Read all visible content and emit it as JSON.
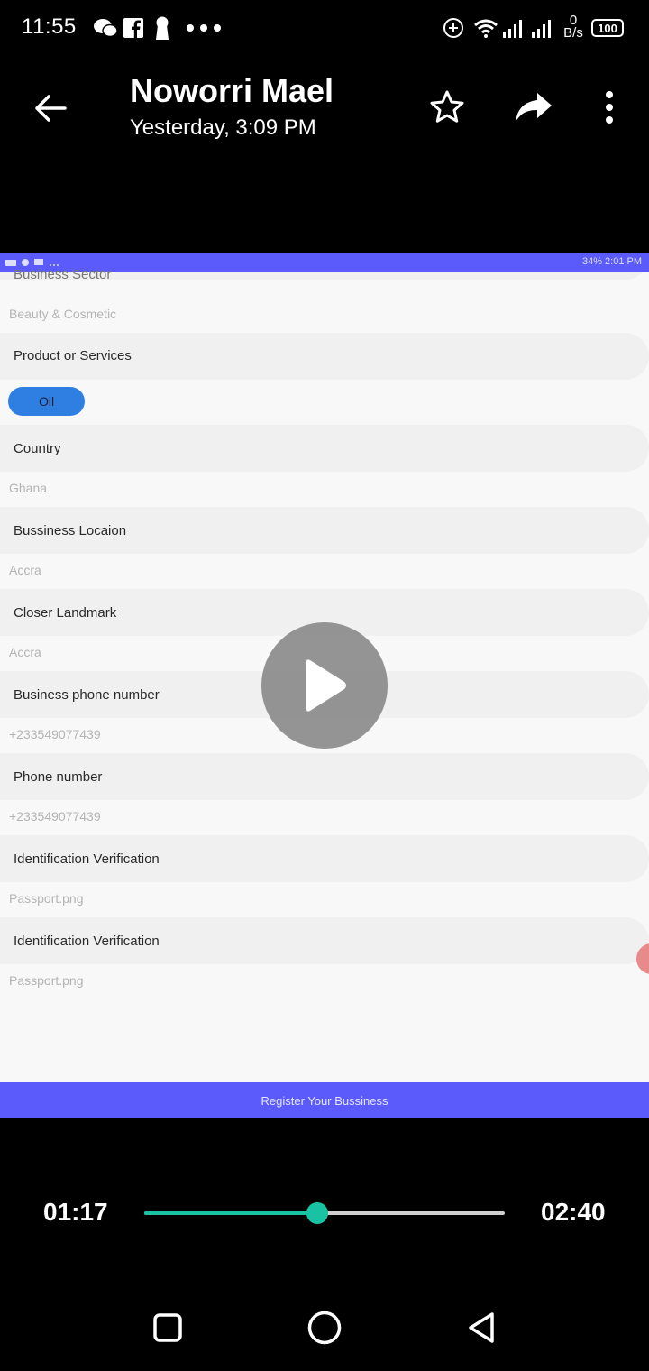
{
  "status_bar": {
    "time": "11:55",
    "left_icons": [
      "wechat-icon",
      "facebook-icon",
      "keyhole-icon",
      "more-dots-icon"
    ],
    "right_icons": [
      "data-saver-icon",
      "wifi-icon",
      "signal-icon",
      "signal-icon"
    ],
    "net_speed_value": "0",
    "net_speed_unit": "B/s",
    "battery": "100"
  },
  "header": {
    "contact_name": "Noworri Mael",
    "timestamp": "Yesterday, 3:09 PM",
    "icons": [
      "back-arrow-icon",
      "star-icon",
      "share-icon",
      "more-vert-icon"
    ]
  },
  "video": {
    "inner_status_right": "34% 2:01 PM",
    "fields": [
      {
        "label": "Business Sector",
        "value": "Beauty & Cosmetic"
      },
      {
        "label": "Product or Services",
        "chip": "Oil"
      },
      {
        "label": "Country",
        "value": "Ghana"
      },
      {
        "label": "Bussiness Locaion",
        "value": "Accra"
      },
      {
        "label": "Closer Landmark",
        "value": "Accra"
      },
      {
        "label": "Business phone number",
        "value": "+233549077439"
      },
      {
        "label": "Phone number",
        "value": "+233549077439"
      },
      {
        "label": "Identification Verification",
        "value": "Passport.png"
      },
      {
        "label": "Identification Verification",
        "value": "Passport.png"
      }
    ],
    "register_label": "Register Your Bussiness"
  },
  "player": {
    "current_time": "01:17",
    "total_time": "02:40",
    "progress": 0.48,
    "accent_color": "#19c2a3"
  },
  "nav": {
    "icons": [
      "recents-square-icon",
      "home-circle-icon",
      "back-triangle-icon"
    ]
  }
}
